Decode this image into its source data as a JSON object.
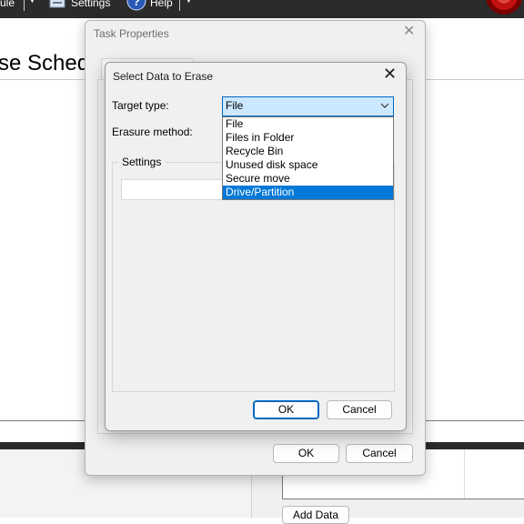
{
  "toolbar": {
    "schedule_fragment": "ule",
    "settings_label": "Settings",
    "help_label": "Help"
  },
  "main": {
    "title_fragment": "se Sched"
  },
  "task_properties": {
    "title": "Task Properties",
    "ok_label": "OK",
    "cancel_label": "Cancel"
  },
  "select_data": {
    "title": "Select Data to Erase",
    "target_type_label": "Target type:",
    "target_type_value": "File",
    "erasure_method_label": "Erasure method:",
    "settings_label": "Settings",
    "options": [
      "File",
      "Files in Folder",
      "Recycle Bin",
      "Unused disk space",
      "Secure move",
      "Drive/Partition"
    ],
    "highlighted_option": "Drive/Partition",
    "ok_label": "OK",
    "cancel_label": "Cancel"
  },
  "lower": {
    "add_data_label": "Add Data"
  },
  "colors": {
    "accent": "#0067c0",
    "highlight": "#0078d7",
    "combo_bg": "#cce8ff",
    "toolbar_bg": "#2b2b2b"
  }
}
